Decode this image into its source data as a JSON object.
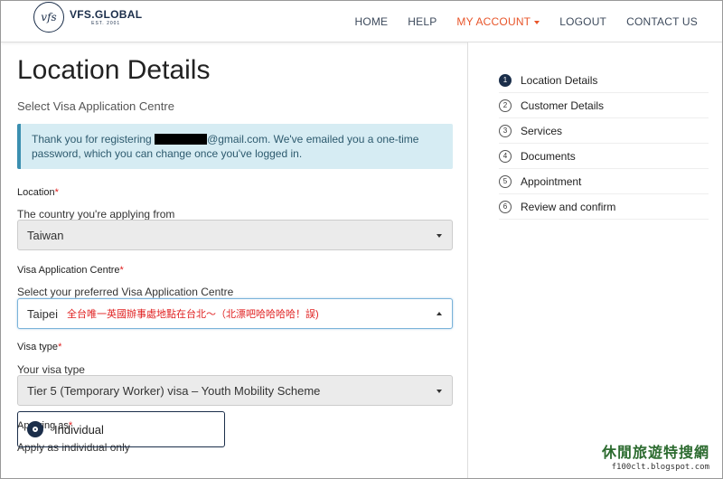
{
  "brand": {
    "logo_mark": "vfs",
    "name": "VFS.GLOBAL",
    "est": "EST. 2001"
  },
  "nav": {
    "items": [
      {
        "label": "HOME"
      },
      {
        "label": "HELP"
      },
      {
        "label": "MY ACCOUNT",
        "active": true
      },
      {
        "label": "LOGOUT"
      },
      {
        "label": "CONTACT US"
      }
    ]
  },
  "page": {
    "title": "Location Details",
    "subtitle": "Select Visa Application Centre"
  },
  "alert": {
    "text_before": "Thank you for registering",
    "text_after": "@gmail.com. We've emailed you a one-time password, which you can change once you've logged in."
  },
  "form": {
    "location": {
      "label": "Location",
      "hint": "The country you're applying from",
      "value": "Taiwan"
    },
    "centre": {
      "label": "Visa Application Centre",
      "hint": "Select your preferred Visa Application Centre",
      "value": "Taipei",
      "annotation": "全台唯一英國辦事處地點在台北～（北漂吧哈哈哈哈！誤)"
    },
    "visa_type": {
      "label": "Visa type",
      "hint": "Your visa type",
      "value": "Tier 5 (Temporary Worker) visa – Youth Mobility Scheme"
    },
    "applying_as": {
      "label": "Applying as",
      "hint": "Apply as individual only",
      "option": "Individual"
    },
    "required_mark": "*"
  },
  "steps": [
    {
      "num": "1",
      "label": "Location Details"
    },
    {
      "num": "2",
      "label": "Customer Details"
    },
    {
      "num": "3",
      "label": "Services"
    },
    {
      "num": "4",
      "label": "Documents"
    },
    {
      "num": "5",
      "label": "Appointment"
    },
    {
      "num": "6",
      "label": "Review and confirm"
    }
  ],
  "watermark": {
    "title": "休閒旅遊特搜網",
    "url": "f100clt.blogspot.com"
  },
  "colors": {
    "accent": "#e8552a",
    "navy": "#1b2e4a",
    "alert_bg": "#d6ecf3",
    "required": "#e02020"
  }
}
